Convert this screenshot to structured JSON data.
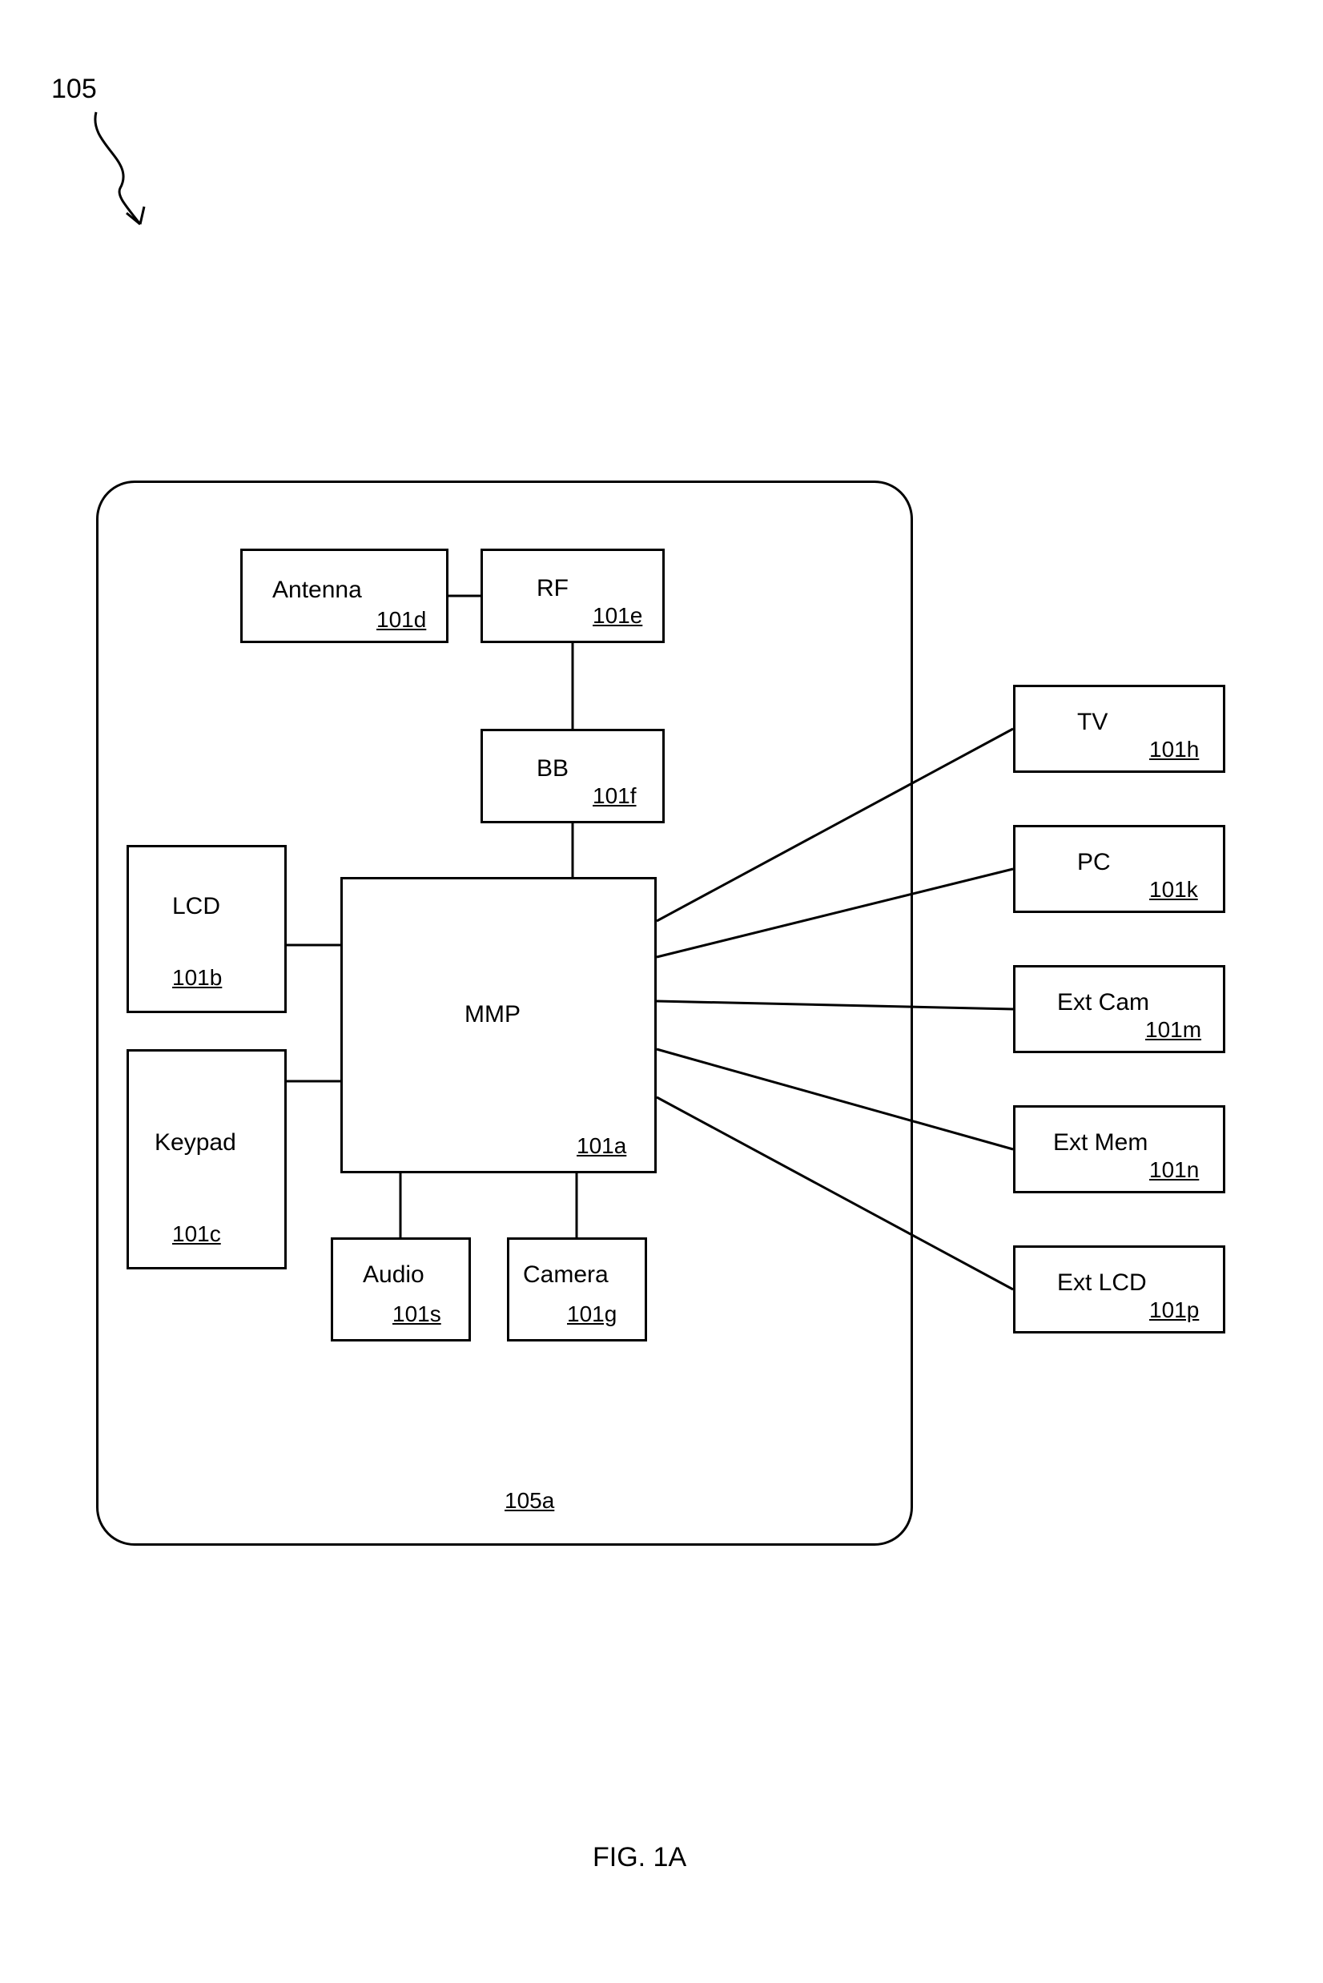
{
  "figure": {
    "caption": "FIG. 1A",
    "toplabel": "105"
  },
  "container": {
    "ref": "105a"
  },
  "blocks": {
    "antenna": {
      "label": "Antenna",
      "ref": "101d"
    },
    "rf": {
      "label": "RF",
      "ref": "101e"
    },
    "bb": {
      "label": "BB",
      "ref": "101f"
    },
    "lcd": {
      "label": "LCD",
      "ref": "101b"
    },
    "keypad": {
      "label": "Keypad",
      "ref": "101c"
    },
    "mmp": {
      "label": "MMP",
      "ref": "101a"
    },
    "audio": {
      "label": "Audio",
      "ref": "101s"
    },
    "camera": {
      "label": "Camera",
      "ref": "101g"
    },
    "tv": {
      "label": "TV",
      "ref": "101h"
    },
    "pc": {
      "label": "PC",
      "ref": "101k"
    },
    "extcam": {
      "label": "Ext Cam",
      "ref": "101m"
    },
    "extmem": {
      "label": "Ext Mem",
      "ref": "101n"
    },
    "extlcd": {
      "label": "Ext LCD",
      "ref": "101p"
    }
  }
}
